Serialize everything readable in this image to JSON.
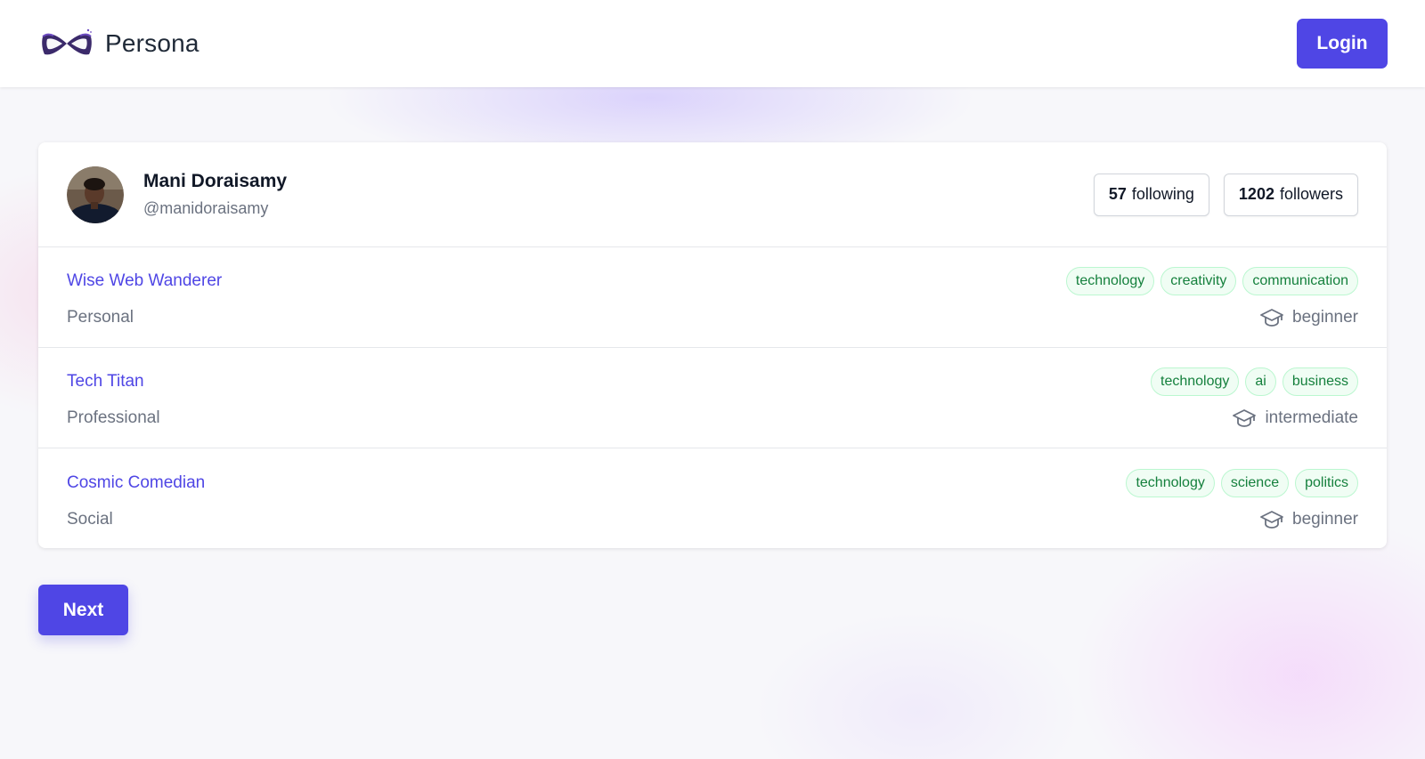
{
  "header": {
    "brand_name": "Persona",
    "logo_icon": "infinity-mask-logo",
    "login_label": "Login"
  },
  "profile": {
    "name": "Mani Doraisamy",
    "handle": "@manidoraisamy",
    "following_count": "57",
    "following_label": "following",
    "followers_count": "1202",
    "followers_label": "followers"
  },
  "personas": [
    {
      "title": "Wise Web Wanderer",
      "type": "Personal",
      "tags": [
        "technology",
        "creativity",
        "communication"
      ],
      "level": "beginner",
      "level_icon": "graduation-cap-icon"
    },
    {
      "title": "Tech Titan",
      "type": "Professional",
      "tags": [
        "technology",
        "ai",
        "business"
      ],
      "level": "intermediate",
      "level_icon": "graduation-cap-icon"
    },
    {
      "title": "Cosmic Comedian",
      "type": "Social",
      "tags": [
        "technology",
        "science",
        "politics"
      ],
      "level": "beginner",
      "level_icon": "graduation-cap-icon"
    }
  ],
  "footer": {
    "next_label": "Next"
  },
  "colors": {
    "accent": "#4f46e5",
    "tag_text": "#15803d",
    "tag_bg": "#f0fdf4",
    "muted_text": "#6b7280"
  }
}
